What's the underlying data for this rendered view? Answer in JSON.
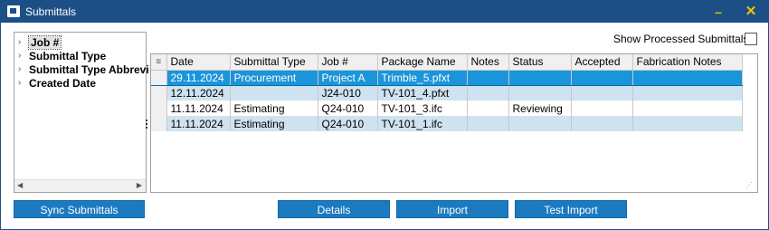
{
  "window": {
    "title": "Submittals",
    "minimize_label": "–",
    "close_label": "✕"
  },
  "tree": {
    "items": [
      {
        "label": "Job #",
        "selected": true
      },
      {
        "label": "Submittal Type",
        "selected": false
      },
      {
        "label": "Submittal Type Abbrevi",
        "selected": false
      },
      {
        "label": "Created Date",
        "selected": false
      }
    ]
  },
  "show_processed": {
    "label": "Show Processed Submittals:",
    "checked": false
  },
  "grid": {
    "columns": [
      "Date",
      "Submittal Type",
      "Job #",
      "Package Name",
      "Notes",
      "Status",
      "Accepted",
      "Fabrication Notes"
    ],
    "rows": [
      {
        "date": "29.11.2024",
        "type": "Procurement",
        "job": "Project A",
        "package": "Trimble_5.pfxt",
        "notes": "",
        "status": "",
        "accepted": "",
        "fab_notes": "",
        "selected": true
      },
      {
        "date": "12.11.2024",
        "type": "",
        "job": "J24-010",
        "package": "TV-101_4.pfxt",
        "notes": "",
        "status": "",
        "accepted": "",
        "fab_notes": "",
        "selected": false
      },
      {
        "date": "11.11.2024",
        "type": "Estimating",
        "job": "Q24-010",
        "package": "TV-101_3.ifc",
        "notes": "",
        "status": "Reviewing",
        "accepted": "",
        "fab_notes": "",
        "selected": false
      },
      {
        "date": "11.11.2024",
        "type": "Estimating",
        "job": "Q24-010",
        "package": "TV-101_1.ifc",
        "notes": "",
        "status": "",
        "accepted": "",
        "fab_notes": "",
        "selected": false
      }
    ]
  },
  "buttons": {
    "sync": "Sync Submittals",
    "details": "Details",
    "import": "Import",
    "test_import": "Test Import"
  },
  "colors": {
    "titlebar": "#1d4f87",
    "selected_row": "#1b95d9",
    "alt_row": "#cfe2f0",
    "button": "#1b7ac0"
  }
}
